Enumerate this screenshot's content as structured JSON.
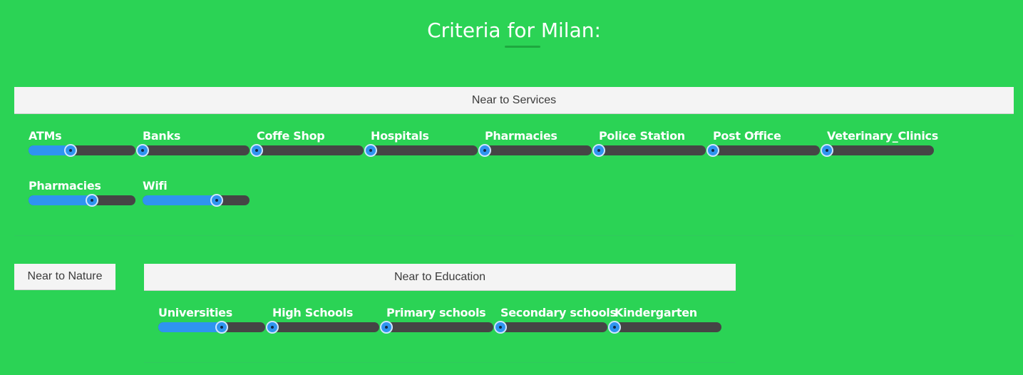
{
  "page": {
    "title": "Criteria for Milan:"
  },
  "services": {
    "header": "Near to Services",
    "sliders": [
      {
        "label": "ATMs",
        "value": 0.39
      },
      {
        "label": "Banks",
        "value": 0.0
      },
      {
        "label": "Coffe Shop",
        "value": 0.0
      },
      {
        "label": "Hospitals",
        "value": 0.0
      },
      {
        "label": "Pharmacies",
        "value": 0.0
      },
      {
        "label": "Police Station",
        "value": 0.0
      },
      {
        "label": "Post Office",
        "value": 0.0
      },
      {
        "label": "Veterinary_Clinics",
        "value": 0.0
      },
      {
        "label": "Pharmacies",
        "value": 0.59
      },
      {
        "label": "Wifi",
        "value": 0.69
      }
    ]
  },
  "nature": {
    "button_label": "Near to Nature"
  },
  "education": {
    "header": "Near to Education",
    "sliders": [
      {
        "label": "Universities",
        "value": 0.59
      },
      {
        "label": "High Schools",
        "value": 0.0
      },
      {
        "label": "Primary schools",
        "value": 0.0
      },
      {
        "label": "Secondary schools",
        "value": 0.0
      },
      {
        "label": "Kindergarten",
        "value": 0.0
      }
    ]
  },
  "colors": {
    "background": "#2bd355",
    "slider_fill": "#2f94f0",
    "slider_track": "#454545",
    "panel": "#f4f4f4"
  }
}
